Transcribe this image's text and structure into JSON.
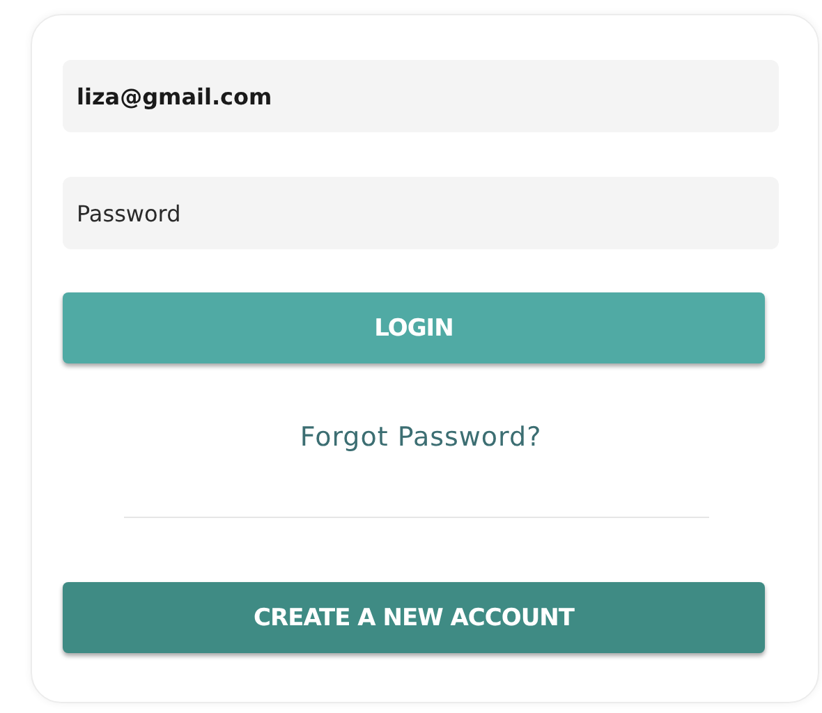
{
  "email_field": {
    "value": "liza@gmail.com"
  },
  "password_field": {
    "placeholder": "Password"
  },
  "login_button": {
    "label": "LOGIN"
  },
  "forgot_link": {
    "label": "Forgot Password?"
  },
  "create_button": {
    "label": "CREATE A NEW ACCOUNT"
  }
}
